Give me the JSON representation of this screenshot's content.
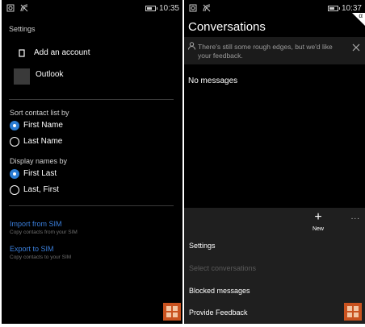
{
  "left_screen": {
    "status": {
      "time": "10:35"
    },
    "page_title": "Settings",
    "accounts": {
      "add_account": "Add an account",
      "outlook": "Outlook"
    },
    "sort_group": {
      "label": "Sort contact list by",
      "options": [
        "First Name",
        "Last Name"
      ],
      "selected": "First Name"
    },
    "display_group": {
      "label": "Display names by",
      "options": [
        "First Last",
        "Last, First"
      ],
      "selected": "First Last"
    },
    "sim": {
      "import_label": "Import from SIM",
      "import_sub": "Copy contacts from your SIM",
      "export_label": "Export to SIM",
      "export_sub": "Copy contacts to your SIM"
    }
  },
  "right_screen": {
    "status": {
      "time": "10:37"
    },
    "badge": "α",
    "title": "Conversations",
    "banner_text_line1": "There's still some rough edges, but we'd like",
    "banner_text_line2": "your feedback.",
    "empty_text": "No messages",
    "appbar": {
      "new_label": "New",
      "new_glyph": "+",
      "more_glyph": "..."
    },
    "menu": {
      "items": [
        "Settings",
        "Select conversations",
        "Blocked messages",
        "Provide Feedback"
      ],
      "disabled_item": "Select conversations"
    }
  },
  "colors": {
    "accent": "#2b7cd3",
    "link": "#3a7fdc",
    "background": "#000000",
    "menu_background": "#1f1f1f"
  }
}
